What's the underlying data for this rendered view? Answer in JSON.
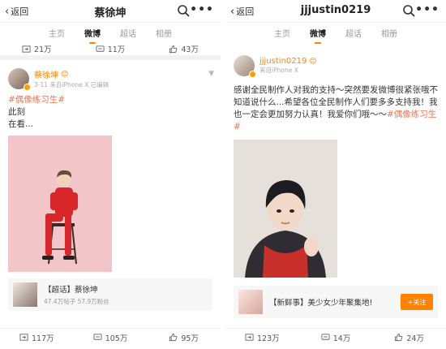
{
  "left": {
    "back_label": "返回",
    "title": "蔡徐坤",
    "tabs": [
      "主页",
      "微博",
      "超话",
      "相册"
    ],
    "active_tab": "微博",
    "prev_stats": {
      "repost": "21万",
      "comment": "11万",
      "like": "43万"
    },
    "post": {
      "author": "蔡徐坤",
      "meta": "3-11  来自iPhone X  已编辑",
      "hashtag": "#偶像练习生#",
      "line1": "此刻",
      "line2": "在看..."
    },
    "card": {
      "title": "【超话】蔡徐坤",
      "sub": "47.4万帖子  57.9万粉丝"
    },
    "stats": {
      "repost": "117万",
      "comment": "105万",
      "like": "95万"
    }
  },
  "right": {
    "back_label": "返回",
    "title": "jjjustin0219",
    "tabs": [
      "主页",
      "微博",
      "超话",
      "相册"
    ],
    "active_tab": "微博",
    "post": {
      "author": "jjjustin0219",
      "meta": "来自iPhone X",
      "text": "感谢全民制作人对我的支持～突然要发微博很紧张哦不知道说什么...希望各位全民制作人们要多多支持我！我也一定会更加努力认真！我爱你们哦～～",
      "hashtag": "#偶像练习生#"
    },
    "card": {
      "title": "【新鲜事】美少女少年聚集地!",
      "button": "+关注"
    },
    "stats": {
      "repost": "123万",
      "comment": "14万",
      "like": "24万"
    }
  },
  "colors": {
    "accent": "#ff8200",
    "hashtag": "#eb7350",
    "photo_left_bg": "#f0c8ca"
  },
  "icons": [
    "back-chevron-icon",
    "search-icon",
    "more-icon",
    "repost-icon",
    "comment-icon",
    "like-icon",
    "verified-icon",
    "dropdown-icon"
  ]
}
